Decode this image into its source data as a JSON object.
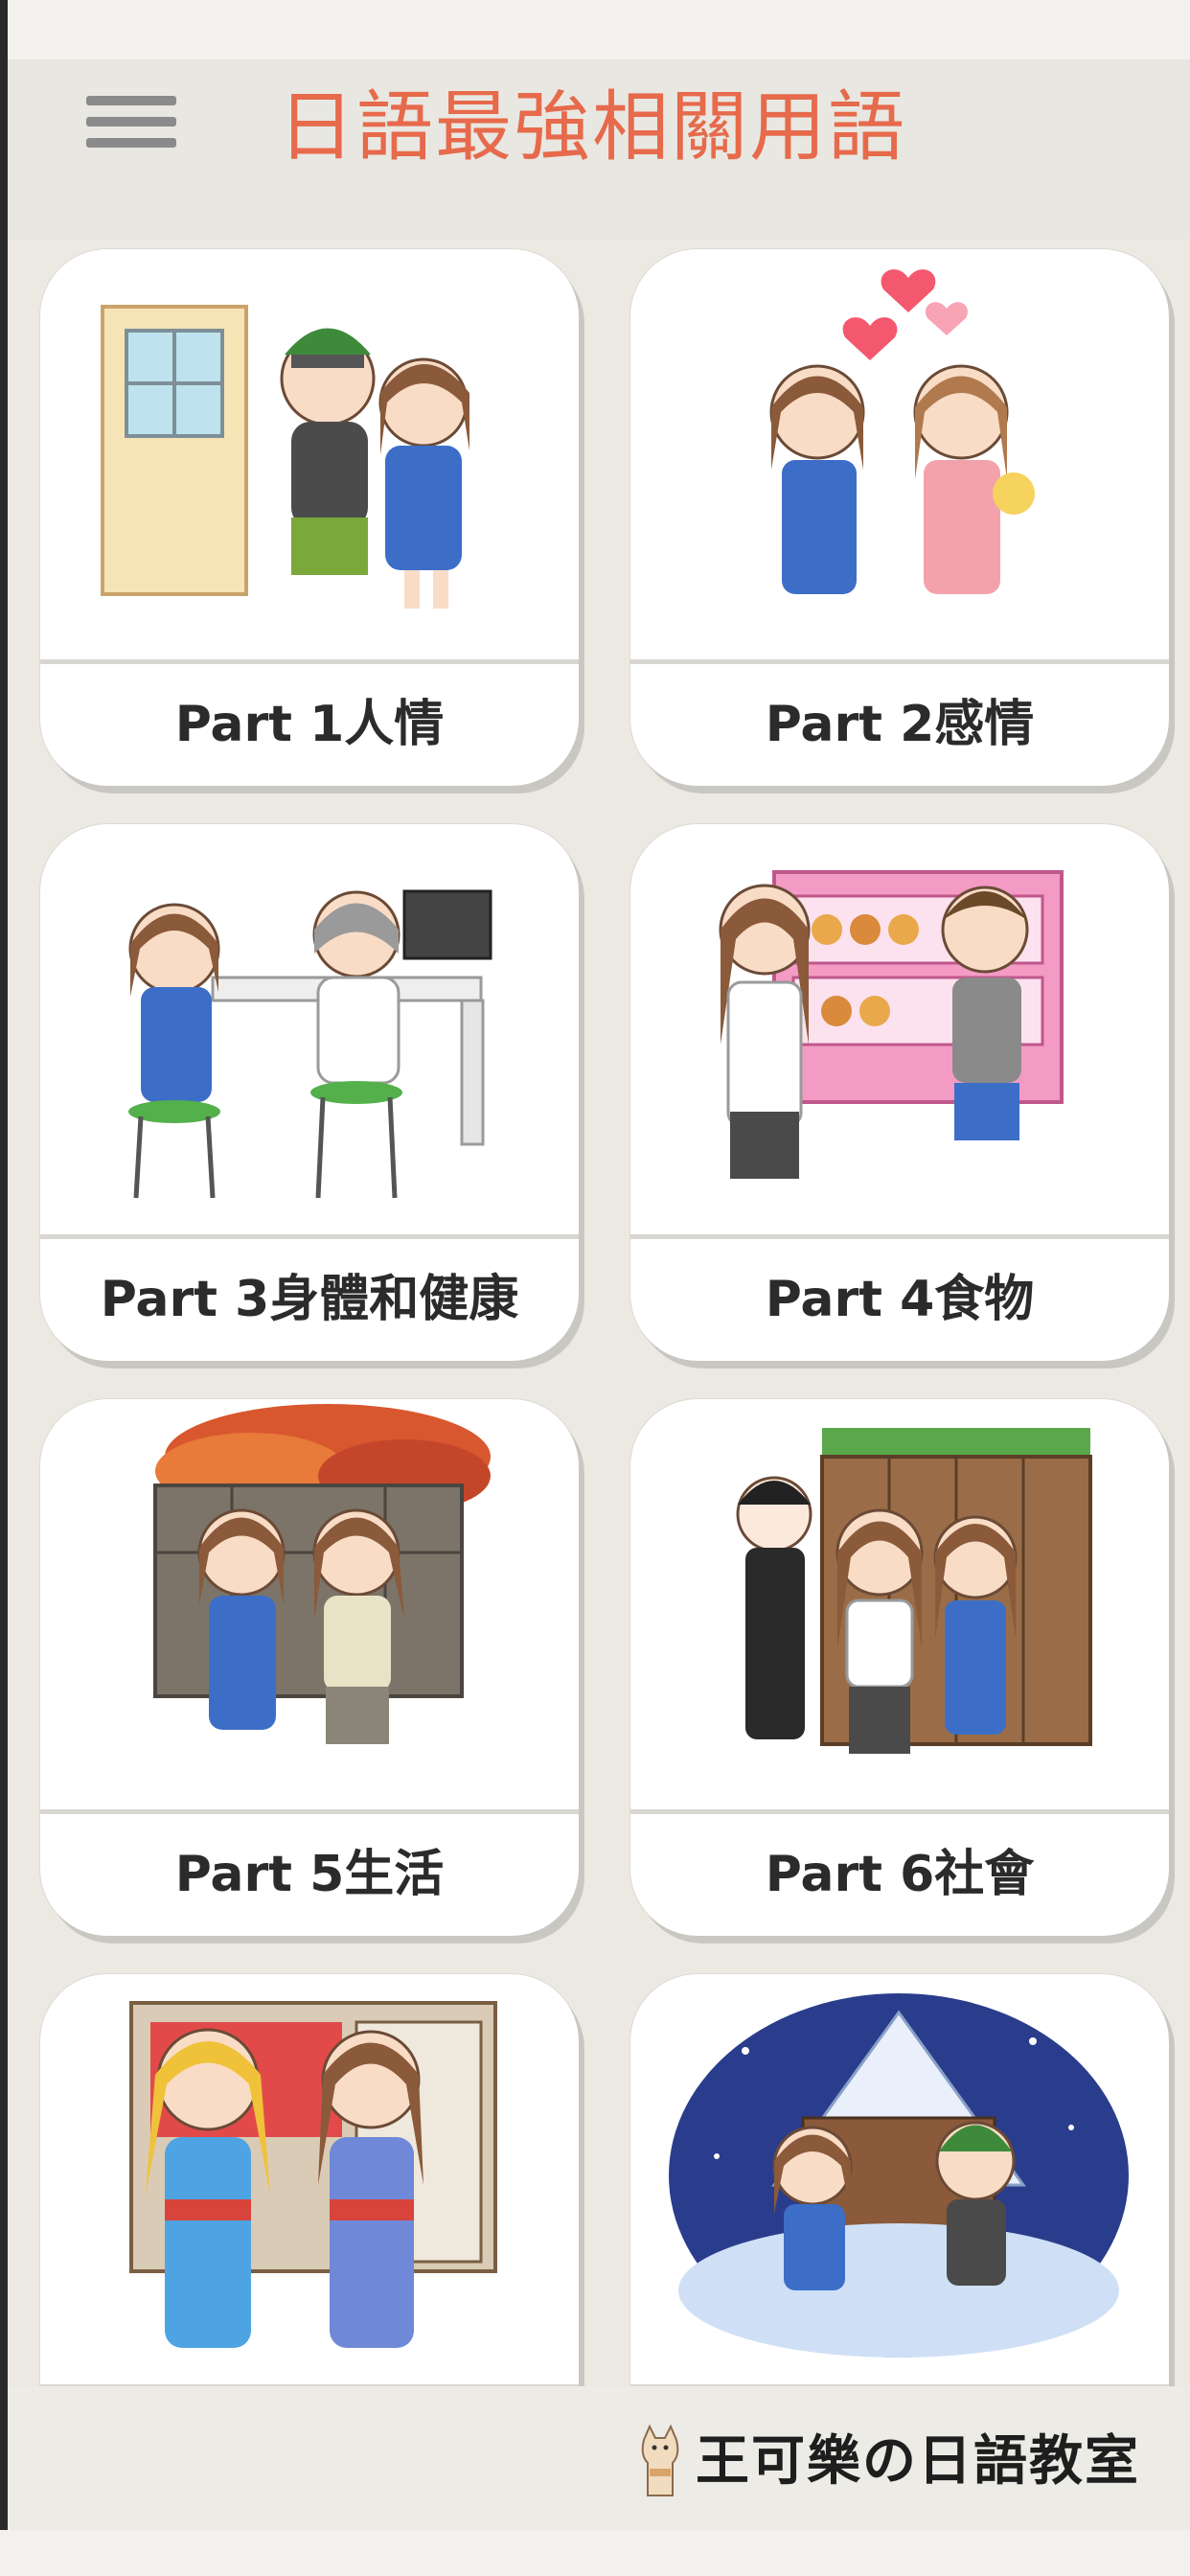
{
  "header": {
    "title": "日語最強相關用語",
    "menu_icon": "hamburger-menu-icon",
    "title_color": "#e66a4b"
  },
  "cards": [
    {
      "label": "Part 1人情",
      "illustration": "couple-at-window-illustration"
    },
    {
      "label": "Part 2感情",
      "illustration": "friends-with-hearts-illustration"
    },
    {
      "label": "Part 3身體和健康",
      "illustration": "doctor-visit-illustration"
    },
    {
      "label": "Part 4食物",
      "illustration": "bakery-display-illustration"
    },
    {
      "label": "Part 5生活",
      "illustration": "autumn-leaves-illustration"
    },
    {
      "label": "Part 6社會",
      "illustration": "kyoto-street-illustration"
    },
    {
      "label": "",
      "illustration": "yukata-girls-illustration"
    },
    {
      "label": "",
      "illustration": "snowy-house-illustration"
    }
  ],
  "footer": {
    "brand": "王可樂の日語教室",
    "logo_icon": "cat-logo-icon"
  },
  "colors": {
    "background": "#ece9e3",
    "card": "#ffffff",
    "label_text": "#2b2b2b"
  }
}
